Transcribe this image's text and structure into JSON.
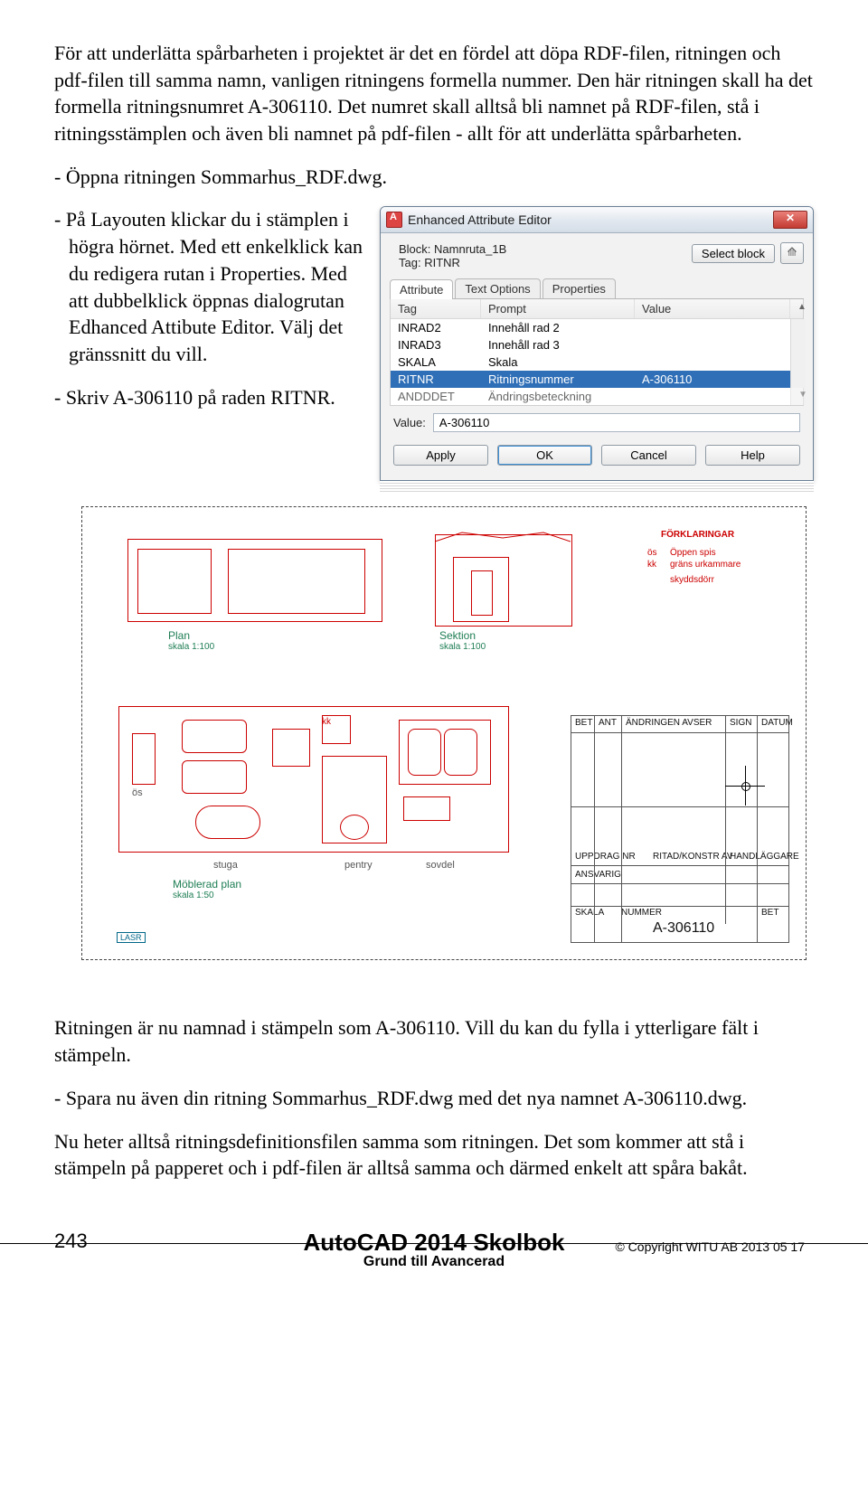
{
  "para1": "För att underlätta spårbarheten i projektet är det en fördel att döpa RDF-filen, rit­ningen och pdf-filen till samma namn, vanligen ritningens formella nummer. Den här ritningen skall ha det formella ritningsnumret A-306110. Det numret skall alltså bli namnet på RDF-filen, stå i ritningsstämplen och även bli namnet på pdf-filen - allt för att underlätta spårbarheten.",
  "b1": "-  Öppna ritningen Sommarhus_RDF.dwg.",
  "b2": "-  På Layouten klickar du i stämplen i högra hörnet. Med ett enkelklick kan du redigera rutan i Properties. Med att dubbelklick öppnas dia­logrutan Edhanced Attibute Editor. Välj det gränssnitt du vill.",
  "b3": "-  Skriv A-306110 på raden RITNR.",
  "para2": "Ritningen är nu namnad i stämpeln som A-306110. Vill du kan du fylla i ytterli­gare fält i stämpeln.",
  "b4": "-  Spara nu även din ritning Sommarhus_RDF.dwg med det nya namnet A-306110.dwg.",
  "para3": "Nu heter alltså ritningsdefinitionsfilen samma som ritningen. Det som kommer att stå i stämpeln på papperet och i pdf-filen är alltså samma och därmed enkelt att spåra bakåt.",
  "dialog": {
    "title": "Enhanced Attribute Editor",
    "block_lbl": "Block:",
    "block_val": "Namnruta_1B",
    "tag_lbl": "Tag:",
    "tag_val": "RITNR",
    "select_block": "Select block",
    "tabs": [
      "Attribute",
      "Text Options",
      "Properties"
    ],
    "cols": [
      "Tag",
      "Prompt",
      "Value"
    ],
    "rows": [
      {
        "t": "INRAD2",
        "p": "Innehåll rad 2",
        "v": ""
      },
      {
        "t": "INRAD3",
        "p": "Innehåll rad 3",
        "v": ""
      },
      {
        "t": "SKALA",
        "p": "Skala",
        "v": ""
      },
      {
        "t": "RITNR",
        "p": "Ritningsnummer",
        "v": "A-306110"
      },
      {
        "t": "ANDDDET",
        "p": "Ändringsbeteckning",
        "v": ""
      }
    ],
    "value_lbl": "Value:",
    "value_val": "A-306110",
    "btn_apply": "Apply",
    "btn_ok": "OK",
    "btn_cancel": "Cancel",
    "btn_help": "Help"
  },
  "drawing": {
    "plan": "Plan",
    "plan_s": "skala 1:100",
    "sektion": "Sektion",
    "sektion_s": "skala 1:100",
    "mob": "Möblerad plan",
    "mob_s": "skala 1:50",
    "fork": "FÖRKLARINGAR",
    "legend": [
      "Öppen spis",
      "gräns urkammare",
      "skyddsdörr"
    ],
    "rooms": [
      "ös",
      "stuga",
      "kök",
      "pentry",
      "sovdel"
    ],
    "tb_bet": "BET",
    "tb_ant": "ANT",
    "tb_andr": "ÄNDRINGEN AVSER",
    "tb_sign": "SIGN",
    "tb_dat": "DATUM",
    "tb_datum": "DATUM",
    "tb_uppd": "UPPDRAG NR",
    "tb_ritad": "RITAD/KONSTR AV",
    "tb_handl": "HANDLÄGGARE",
    "tb_ans": "ANSVARIG",
    "tb_skala": "SKALA",
    "tb_nr": "NUMMER",
    "tb_betc": "BET",
    "ritnr": "A-306110",
    "lasr": "LASR"
  },
  "footer": {
    "page": "243",
    "title": "AutoCAD 2014 Skolbok",
    "sub": "Grund till Avancerad",
    "copy": "Copyright WITU AB 2013 05 17"
  }
}
